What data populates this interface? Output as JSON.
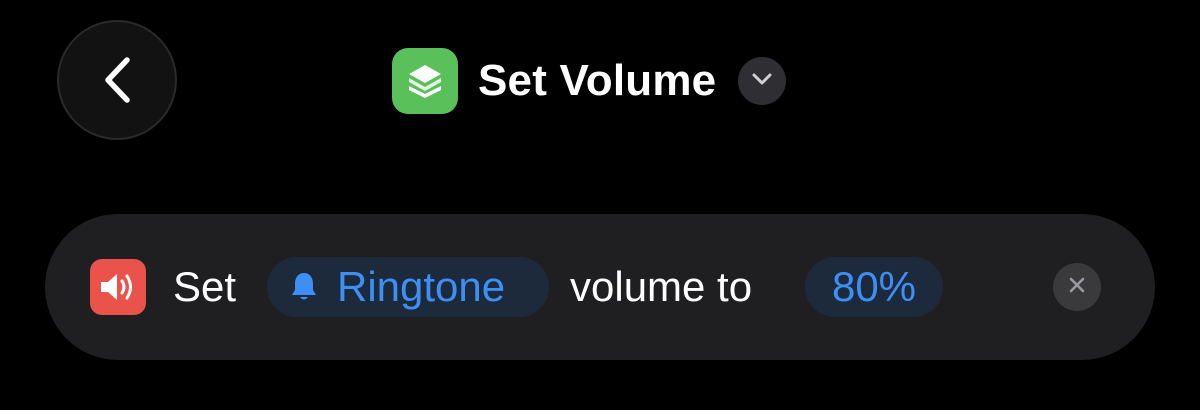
{
  "header": {
    "title": "Set Volume",
    "app_icon": "layers-icon",
    "app_icon_color": "#5ac05a"
  },
  "navigation": {
    "back_icon": "chevron-left-icon"
  },
  "action": {
    "icon": "speaker-volume-icon",
    "icon_color": "#e9534c",
    "prefix_text": "Set",
    "sound_token": {
      "icon": "bell-icon",
      "label": "Ringtone"
    },
    "middle_text": "volume to",
    "level_token": {
      "label": "80%",
      "value": 0.8
    },
    "remove_icon": "close-icon"
  },
  "colors": {
    "background": "#000000",
    "card": "#1f1f21",
    "token_background": "#1d2a3c",
    "token_text": "#3d8ff5"
  }
}
